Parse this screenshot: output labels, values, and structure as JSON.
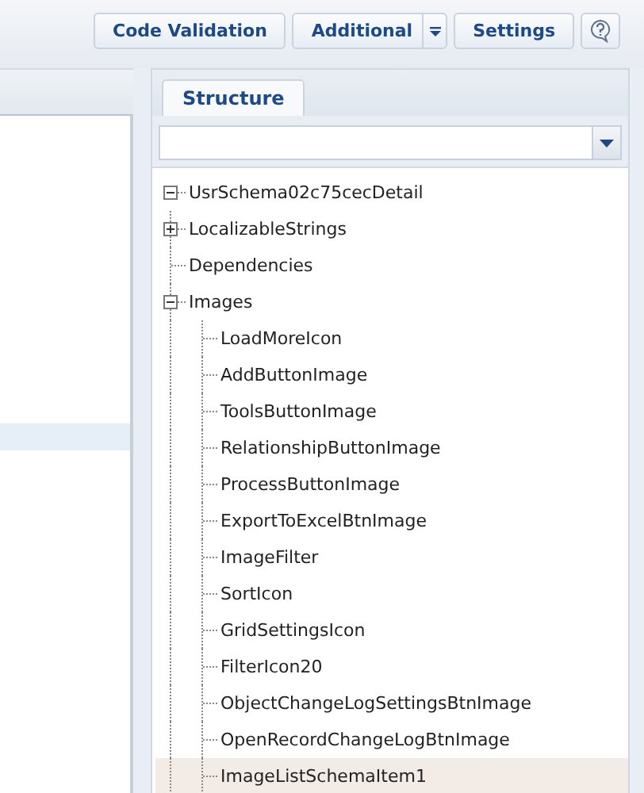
{
  "toolbar": {
    "buttons": [
      {
        "kind": "plain",
        "label": "Code Validation"
      },
      {
        "kind": "split",
        "label": "Additional"
      },
      {
        "kind": "plain",
        "label": "Settings"
      },
      {
        "kind": "help"
      }
    ]
  },
  "left_panel": {
    "rows": [
      {
        "selected": true
      }
    ]
  },
  "structure_panel": {
    "tabs": [
      {
        "label": "Structure",
        "selected": true
      }
    ],
    "tree": [
      {
        "label": "UsrSchema02c75cecDetail",
        "expanded": true,
        "selected": false,
        "children": [
          {
            "label": "LocalizableStrings",
            "expanded": false,
            "has_children": true,
            "selected": false
          },
          {
            "label": "Dependencies",
            "selected": false
          },
          {
            "label": "Images",
            "expanded": true,
            "selected": false,
            "children": [
              {
                "label": "LoadMoreIcon",
                "selected": false
              },
              {
                "label": "AddButtonImage",
                "selected": false
              },
              {
                "label": "ToolsButtonImage",
                "selected": false
              },
              {
                "label": "RelationshipButtonImage",
                "selected": false
              },
              {
                "label": "ProcessButtonImage",
                "selected": false
              },
              {
                "label": "ExportToExcelBtnImage",
                "selected": false
              },
              {
                "label": "ImageFilter",
                "selected": false
              },
              {
                "label": "SortIcon",
                "selected": false
              },
              {
                "label": "GridSettingsIcon",
                "selected": false
              },
              {
                "label": "FilterIcon20",
                "selected": false
              },
              {
                "label": "ObjectChangeLogSettingsBtnImage",
                "selected": false
              },
              {
                "label": "OpenRecordChangeLogBtnImage",
                "selected": false
              },
              {
                "label": "ImageListSchemaItem1",
                "selected": true
              }
            ]
          }
        ]
      }
    ]
  }
}
